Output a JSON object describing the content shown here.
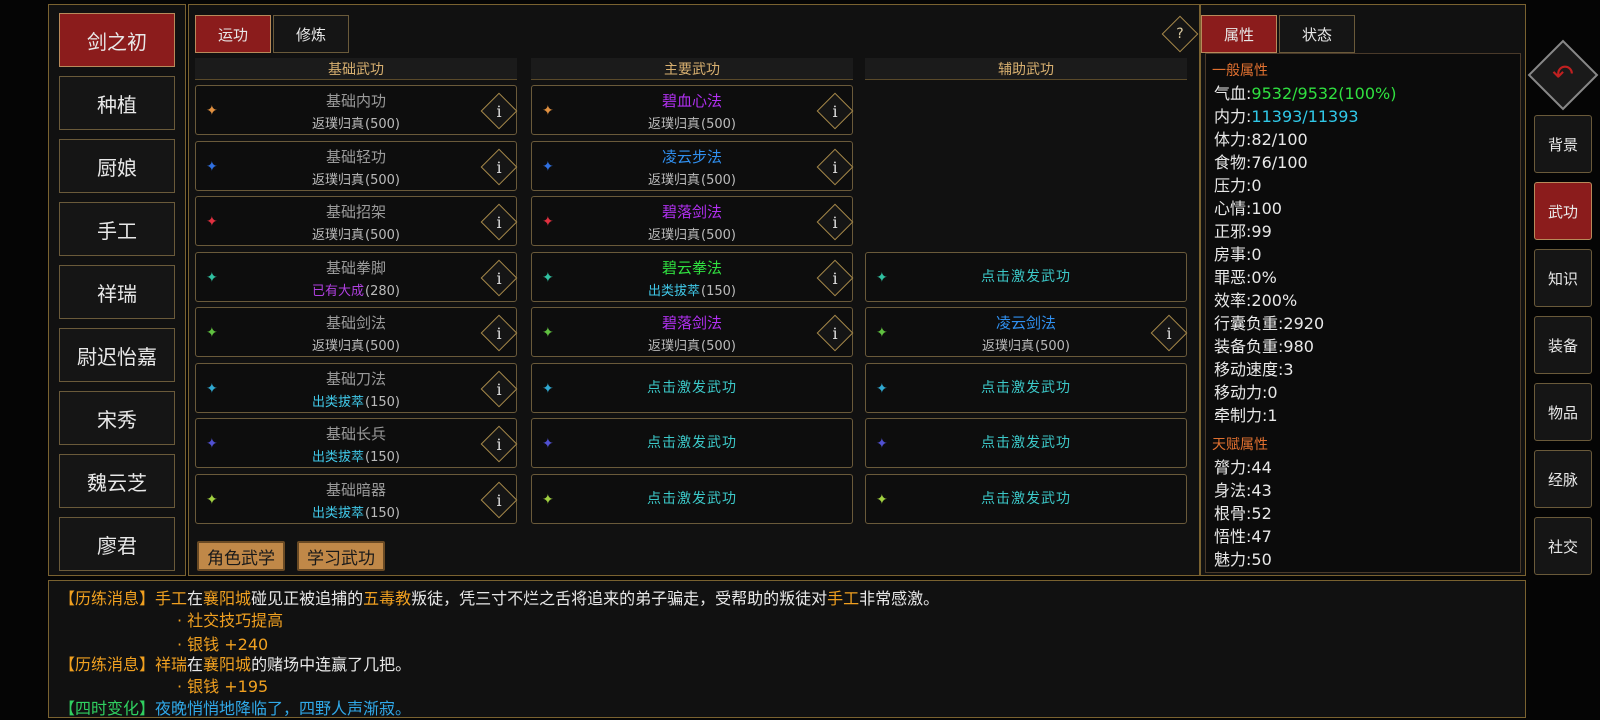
{
  "characters": [
    {
      "name": "剑之初",
      "active": true
    },
    {
      "name": "种植",
      "active": false
    },
    {
      "name": "厨娘",
      "active": false
    },
    {
      "name": "手工",
      "active": false
    },
    {
      "name": "祥瑞",
      "active": false
    },
    {
      "name": "尉迟怡嘉",
      "active": false
    },
    {
      "name": "宋秀",
      "active": false
    },
    {
      "name": "魏云芝",
      "active": false
    },
    {
      "name": "廖君",
      "active": false
    }
  ],
  "tabs": {
    "yungong": "运功",
    "xiulian": "修炼",
    "help": "?"
  },
  "columns": {
    "basic": "基础武功",
    "main": "主要武功",
    "aux": "辅助武功"
  },
  "trigger_text": "点击激发武功",
  "info_glyph": "i",
  "basic_skills": [
    {
      "name": "基础内功",
      "level_name": "返璞归真",
      "level_value": "(500)",
      "level_color": "#bbbbbb",
      "icon_color": "#e09040"
    },
    {
      "name": "基础轻功",
      "level_name": "返璞归真",
      "level_value": "(500)",
      "level_color": "#bbbbbb",
      "icon_color": "#3070e0"
    },
    {
      "name": "基础招架",
      "level_name": "返璞归真",
      "level_value": "(500)",
      "level_color": "#bbbbbb",
      "icon_color": "#e03040"
    },
    {
      "name": "基础拳脚",
      "level_name": "已有大成",
      "level_value": "(280)",
      "level_color": "#b040e0",
      "icon_color": "#30c0a0"
    },
    {
      "name": "基础剑法",
      "level_name": "返璞归真",
      "level_value": "(500)",
      "level_color": "#bbbbbb",
      "icon_color": "#60c040"
    },
    {
      "name": "基础刀法",
      "level_name": "出类拔萃",
      "level_value": "(150)",
      "level_color": "#40c8e8",
      "icon_color": "#30a8d0"
    },
    {
      "name": "基础长兵",
      "level_name": "出类拔萃",
      "level_value": "(150)",
      "level_color": "#40c8e8",
      "icon_color": "#5050d0"
    },
    {
      "name": "基础暗器",
      "level_name": "出类拔萃",
      "level_value": "(150)",
      "level_color": "#40c8e8",
      "icon_color": "#a0d040"
    }
  ],
  "main_skills": [
    {
      "name": "碧血心法",
      "name_color": "#b030f0",
      "level_name": "返璞归真",
      "level_value": "(500)",
      "level_color": "#bbbbbb",
      "icon_color": "#e09040"
    },
    {
      "name": "凌云步法",
      "name_color": "#3090f0",
      "level_name": "返璞归真",
      "level_value": "(500)",
      "level_color": "#bbbbbb",
      "icon_color": "#3070e0"
    },
    {
      "name": "碧落剑法",
      "name_color": "#b030f0",
      "level_name": "返璞归真",
      "level_value": "(500)",
      "level_color": "#bbbbbb",
      "icon_color": "#e03040"
    },
    {
      "name": "碧云拳法",
      "name_color": "#30e040",
      "level_name": "出类拔萃",
      "level_value": "(150)",
      "level_color": "#40c8e8",
      "icon_color": "#30c0a0"
    },
    {
      "name": "碧落剑法",
      "name_color": "#b030f0",
      "level_name": "返璞归真",
      "level_value": "(500)",
      "level_color": "#bbbbbb",
      "icon_color": "#60c040"
    }
  ],
  "main_empty_icons": [
    "#30a8d0",
    "#5050d0",
    "#a0d040"
  ],
  "aux_skills": [
    {
      "row": 3,
      "empty": true,
      "icon_color": "#30c0a0"
    },
    {
      "row": 4,
      "empty": false,
      "name": "凌云剑法",
      "name_color": "#3090f0",
      "level_name": "返璞归真",
      "level_value": "(500)",
      "level_color": "#bbbbbb",
      "icon_color": "#60c040"
    },
    {
      "row": 5,
      "empty": true,
      "icon_color": "#30a8d0"
    },
    {
      "row": 6,
      "empty": true,
      "icon_color": "#5050d0"
    },
    {
      "row": 7,
      "empty": true,
      "icon_color": "#a0d040"
    }
  ],
  "bottom_buttons": {
    "role_martial": "角色武学",
    "learn_martial": "学习武功"
  },
  "right_tabs": {
    "attributes": "属性",
    "status": "状态"
  },
  "general_title": "一般属性",
  "general_attrs": [
    {
      "label": "气血:",
      "value": "9532/9532(100%)",
      "color": "#30e040"
    },
    {
      "label": "内力:",
      "value": "11393/11393",
      "color": "#30c8e8"
    },
    {
      "label": "体力:",
      "value": "82/100",
      "color": "#e8e8e8"
    },
    {
      "label": "食物:",
      "value": "76/100",
      "color": "#e8e8e8"
    },
    {
      "label": "压力:",
      "value": "0",
      "color": "#e8e8e8"
    },
    {
      "label": "心情:",
      "value": "100",
      "color": "#e8e8e8"
    },
    {
      "label": "正邪:",
      "value": "99",
      "color": "#e8e8e8"
    },
    {
      "label": "房事:",
      "value": "0",
      "color": "#e8e8e8"
    },
    {
      "label": "罪恶:",
      "value": "0%",
      "color": "#e8e8e8"
    },
    {
      "label": "效率:",
      "value": "200%",
      "color": "#e8e8e8"
    },
    {
      "label": "行囊负重:",
      "value": "2920",
      "color": "#e8e8e8"
    },
    {
      "label": "装备负重:",
      "value": "980",
      "color": "#e8e8e8"
    },
    {
      "label": "移动速度:",
      "value": "3",
      "color": "#e8e8e8"
    },
    {
      "label": "移动力:",
      "value": "0",
      "color": "#e8e8e8"
    },
    {
      "label": "牵制力:",
      "value": "1",
      "color": "#e8e8e8"
    }
  ],
  "talent_title": "天赋属性",
  "talent_attrs": [
    {
      "label": "膂力:",
      "value": "44"
    },
    {
      "label": "身法:",
      "value": "43"
    },
    {
      "label": "根骨:",
      "value": "52"
    },
    {
      "label": "悟性:",
      "value": "47"
    },
    {
      "label": "魅力:",
      "value": "50"
    }
  ],
  "side_buttons": [
    {
      "label": "背景",
      "active": false
    },
    {
      "label": "武功",
      "active": true
    },
    {
      "label": "知识",
      "active": false
    },
    {
      "label": "装备",
      "active": false
    },
    {
      "label": "物品",
      "active": false
    },
    {
      "label": "经脉",
      "active": false
    },
    {
      "label": "社交",
      "active": false
    }
  ],
  "messages": {
    "m1": {
      "tag": "【历练消息】",
      "who": "手工",
      "t1": "在",
      "place": "襄阳城",
      "t2": "碰见正被追捕的",
      "sect": "五毒教",
      "t3": "叛徒，凭三寸不烂之舌将追来的弟子骗走，受帮助的叛徒对",
      "who2": "手工",
      "t4": "非常感激。"
    },
    "m1_sub1": "· 社交技巧提高",
    "m1_sub2": "· 银钱 +240",
    "m2": {
      "tag": "【历练消息】",
      "who": "祥瑞",
      "t1": "在",
      "place": "襄阳城",
      "t2": "的赌场中连赢了几把。"
    },
    "m2_sub1": "· 银钱 +195",
    "m3": {
      "tag": "【四时变化】",
      "text": "夜晚悄悄地降临了，四野人声渐寂。"
    }
  }
}
